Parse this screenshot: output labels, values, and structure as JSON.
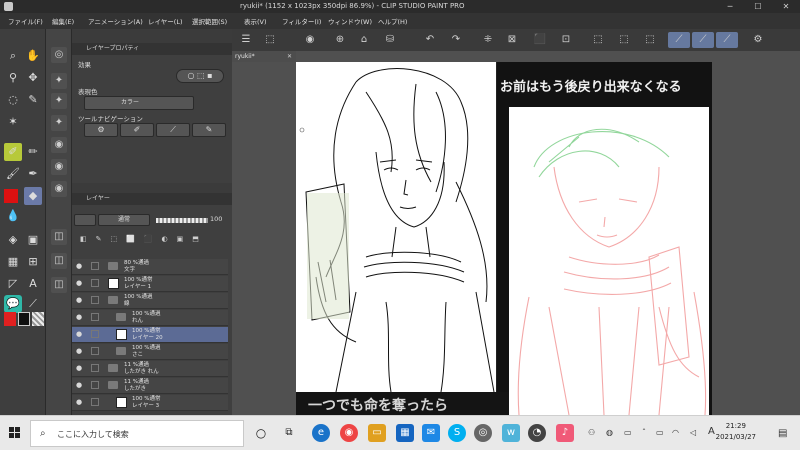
{
  "window": {
    "title": "ryukii* (1152 x 1023px 350dpi 86.9%) - CLIP STUDIO PAINT PRO",
    "min": "─",
    "max": "☐",
    "close": "✕"
  },
  "menu": [
    "ファイル(F)",
    "編集(E)",
    "アニメーション(A)",
    "レイヤー(L)",
    "選択範囲(S)",
    "表示(V)",
    "フィルター(I)",
    "ウィンドウ(W)",
    "ヘルプ(H)"
  ],
  "property_panel": {
    "title": "レイヤープロパティ",
    "effect_label": "効果",
    "color_label": "表現色",
    "color_value": "カラー",
    "toolnav_label": "ツールナビゲーション"
  },
  "layer_panel": {
    "title": "レイヤー",
    "blend_mode": "通常",
    "opacity": "100",
    "layers": [
      {
        "name": "80 %通過\n文字",
        "indent": 0,
        "kind": "folder",
        "selected": false
      },
      {
        "name": "100 %通常\nレイヤー 1",
        "indent": 0,
        "kind": "layer",
        "selected": false
      },
      {
        "name": "100 %通過\n線",
        "indent": 0,
        "kind": "folder",
        "selected": false
      },
      {
        "name": "100 %通過\nれん",
        "indent": 1,
        "kind": "folder",
        "selected": false
      },
      {
        "name": "100 %通常\nレイヤー 20",
        "indent": 1,
        "kind": "layer",
        "selected": true
      },
      {
        "name": "100 %通過\nさこ",
        "indent": 1,
        "kind": "folder",
        "selected": false
      },
      {
        "name": "11 %通過\nしたがき れん",
        "indent": 0,
        "kind": "folder",
        "selected": false
      },
      {
        "name": "11 %通過\nしたがき",
        "indent": 0,
        "kind": "folder",
        "selected": false
      },
      {
        "name": "100 %通常\nレイヤー 3",
        "indent": 1,
        "kind": "layer",
        "selected": false
      }
    ]
  },
  "canvas": {
    "tab_label": "ryukii*",
    "caption_top": "お前はもう後戻り出来なくなる",
    "caption_bottom": "一つでも命を奪ったら",
    "zoom": "86.9",
    "position": "0.0"
  },
  "taskbar": {
    "search_placeholder": "ここに入力して検索",
    "ime": "A",
    "time": "21:29",
    "date": "2021/03/27"
  },
  "colors": {
    "accent": "#6b7aa8",
    "main_color": "#e02020",
    "sub_color": "#101010"
  }
}
